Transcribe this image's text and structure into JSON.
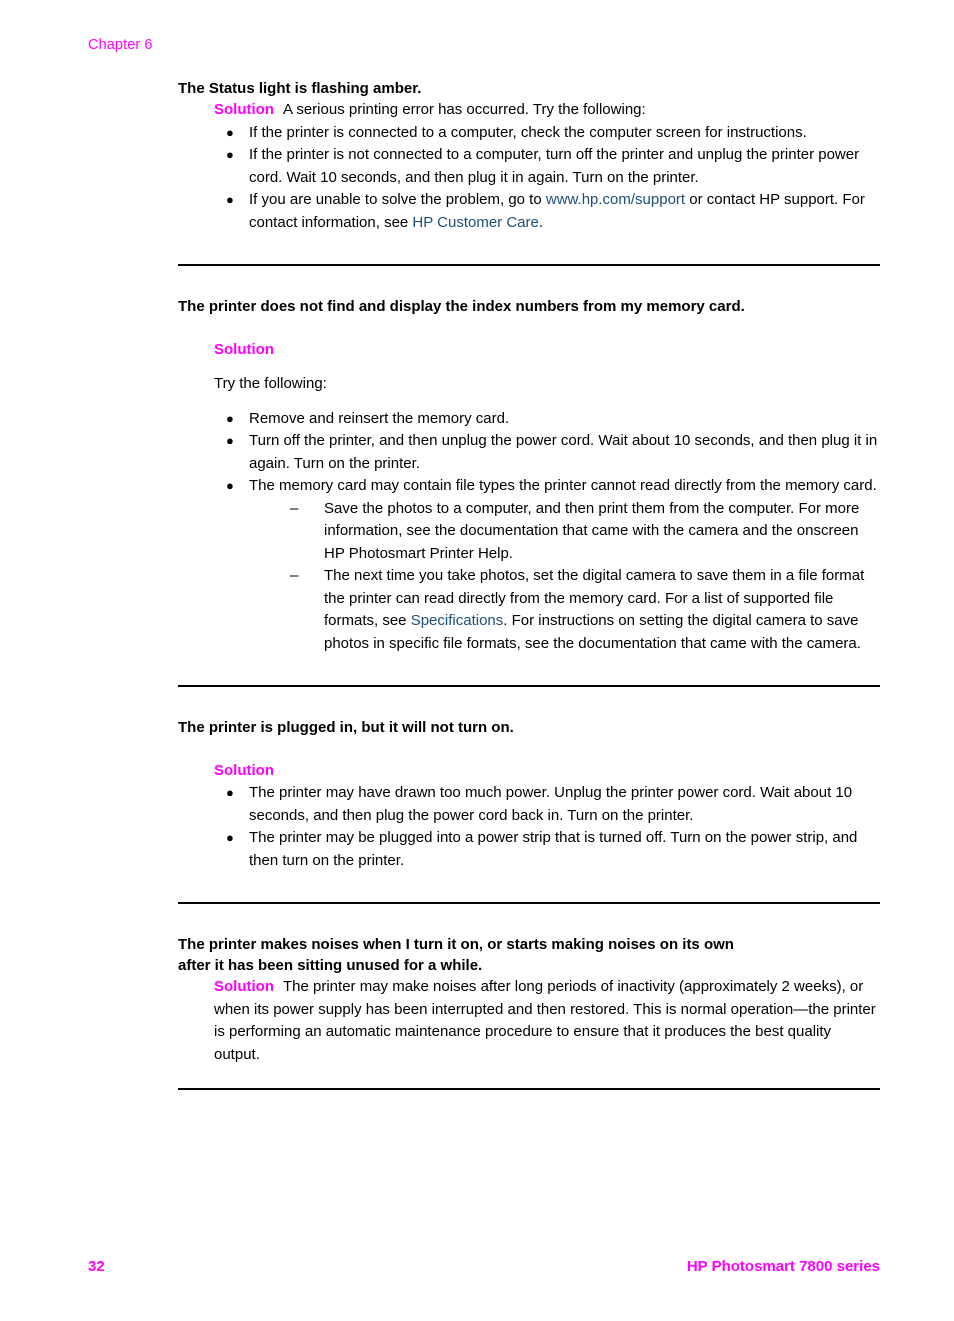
{
  "header": {
    "chapter": "Chapter 6"
  },
  "colors": {
    "solution_magenta": "#FF00FF",
    "link_blue": "#1F4E79",
    "body_text": "#000000",
    "rule": "#000000"
  },
  "sections": [
    {
      "id": "status-light-flashing-amber",
      "heading": "The Status light is flashing amber.",
      "solution_label": "Solution",
      "solution_inline_text": "A serious printing error has occurred. Try the following:",
      "bullets": [
        {
          "parts": [
            {
              "type": "text",
              "value": "If the printer is connected to a computer, check the computer screen for instructions."
            }
          ]
        },
        {
          "parts": [
            {
              "type": "text",
              "value": "If the printer is not connected to a computer, turn off the printer and unplug the printer power cord. Wait 10 seconds, and then plug it in again. Turn on the printer."
            }
          ]
        },
        {
          "parts": [
            {
              "type": "text",
              "value": "If you are unable to solve the problem, go to "
            },
            {
              "type": "link",
              "value": "www.hp.com/support"
            },
            {
              "type": "text",
              "value": " or contact HP support. For contact information, see "
            },
            {
              "type": "link",
              "value": "HP Customer Care"
            },
            {
              "type": "text",
              "value": "."
            }
          ]
        }
      ]
    },
    {
      "id": "printer-does-not-find-index-numbers",
      "heading": "The printer does not find and display the index numbers from my memory card.",
      "solution_label": "Solution",
      "intro": "Try the following:",
      "bullets": [
        {
          "text": "Remove and reinsert the memory card."
        },
        {
          "text": "Turn off the printer, and then unplug the power cord. Wait about 10 seconds, and then plug it in again. Turn on the printer."
        },
        {
          "text": "The memory card may contain file types the printer cannot read directly from the memory card.",
          "subitems": [
            {
              "parts": [
                {
                  "type": "text",
                  "value": "Save the photos to a computer, and then print them from the computer. For more information, see the documentation that came with the camera and the onscreen HP Photosmart Printer Help."
                }
              ]
            },
            {
              "parts": [
                {
                  "type": "text",
                  "value": "The next time you take photos, set the digital camera to save them in a file format the printer can read directly from the memory card. For a list of supported file formats, see "
                },
                {
                  "type": "link",
                  "value": "Specifications"
                },
                {
                  "type": "text",
                  "value": ". For instructions on setting the digital camera to save photos in specific file formats, see the documentation that came with the camera."
                }
              ]
            }
          ]
        }
      ]
    },
    {
      "id": "printer-plugged-in-will-not-turn-on",
      "heading": "The printer is plugged in, but it will not turn on.",
      "solution_label": "Solution",
      "bullets": [
        {
          "text": "The printer may have drawn too much power. Unplug the printer power cord. Wait about 10 seconds, and then plug the power cord back in. Turn on the printer."
        },
        {
          "text": "The printer may be plugged into a power strip that is turned off. Turn on the power strip, and then turn on the printer."
        }
      ]
    },
    {
      "id": "printer-makes-noises",
      "heading_line1": "The printer makes noises when I turn it on, or starts making noises on its own",
      "heading_line2": "after it has been sitting unused for a while.",
      "solution_label": "Solution",
      "solution_inline_text": "The printer may make noises after long periods of inactivity (approximately 2 weeks), or when its power supply has been interrupted and then restored. This is normal operation—the printer is performing an automatic maintenance procedure to ensure that it produces the best quality output."
    }
  ],
  "footer": {
    "page_number": "32",
    "product": "HP Photosmart 7800 series"
  }
}
